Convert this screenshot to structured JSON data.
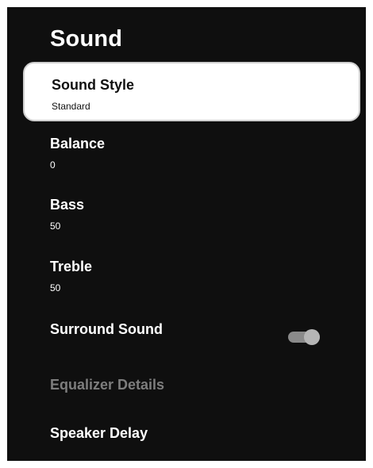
{
  "screen": {
    "title": "Sound"
  },
  "items": [
    {
      "label": "Sound Style",
      "value": "Standard",
      "state": "selected"
    },
    {
      "label": "Balance",
      "value": "0"
    },
    {
      "label": "Bass",
      "value": "50"
    },
    {
      "label": "Treble",
      "value": "50"
    },
    {
      "label": "Surround Sound",
      "toggle": "on"
    },
    {
      "label": "Equalizer Details",
      "state": "disabled"
    },
    {
      "label": "Speaker Delay"
    }
  ],
  "colors": {
    "background": "#0f0f0f",
    "selected_bg": "#ffffff",
    "disabled_text": "#7d7d7d",
    "toggle_track": "#8a8a8a",
    "toggle_knob": "#b5b5b5"
  }
}
